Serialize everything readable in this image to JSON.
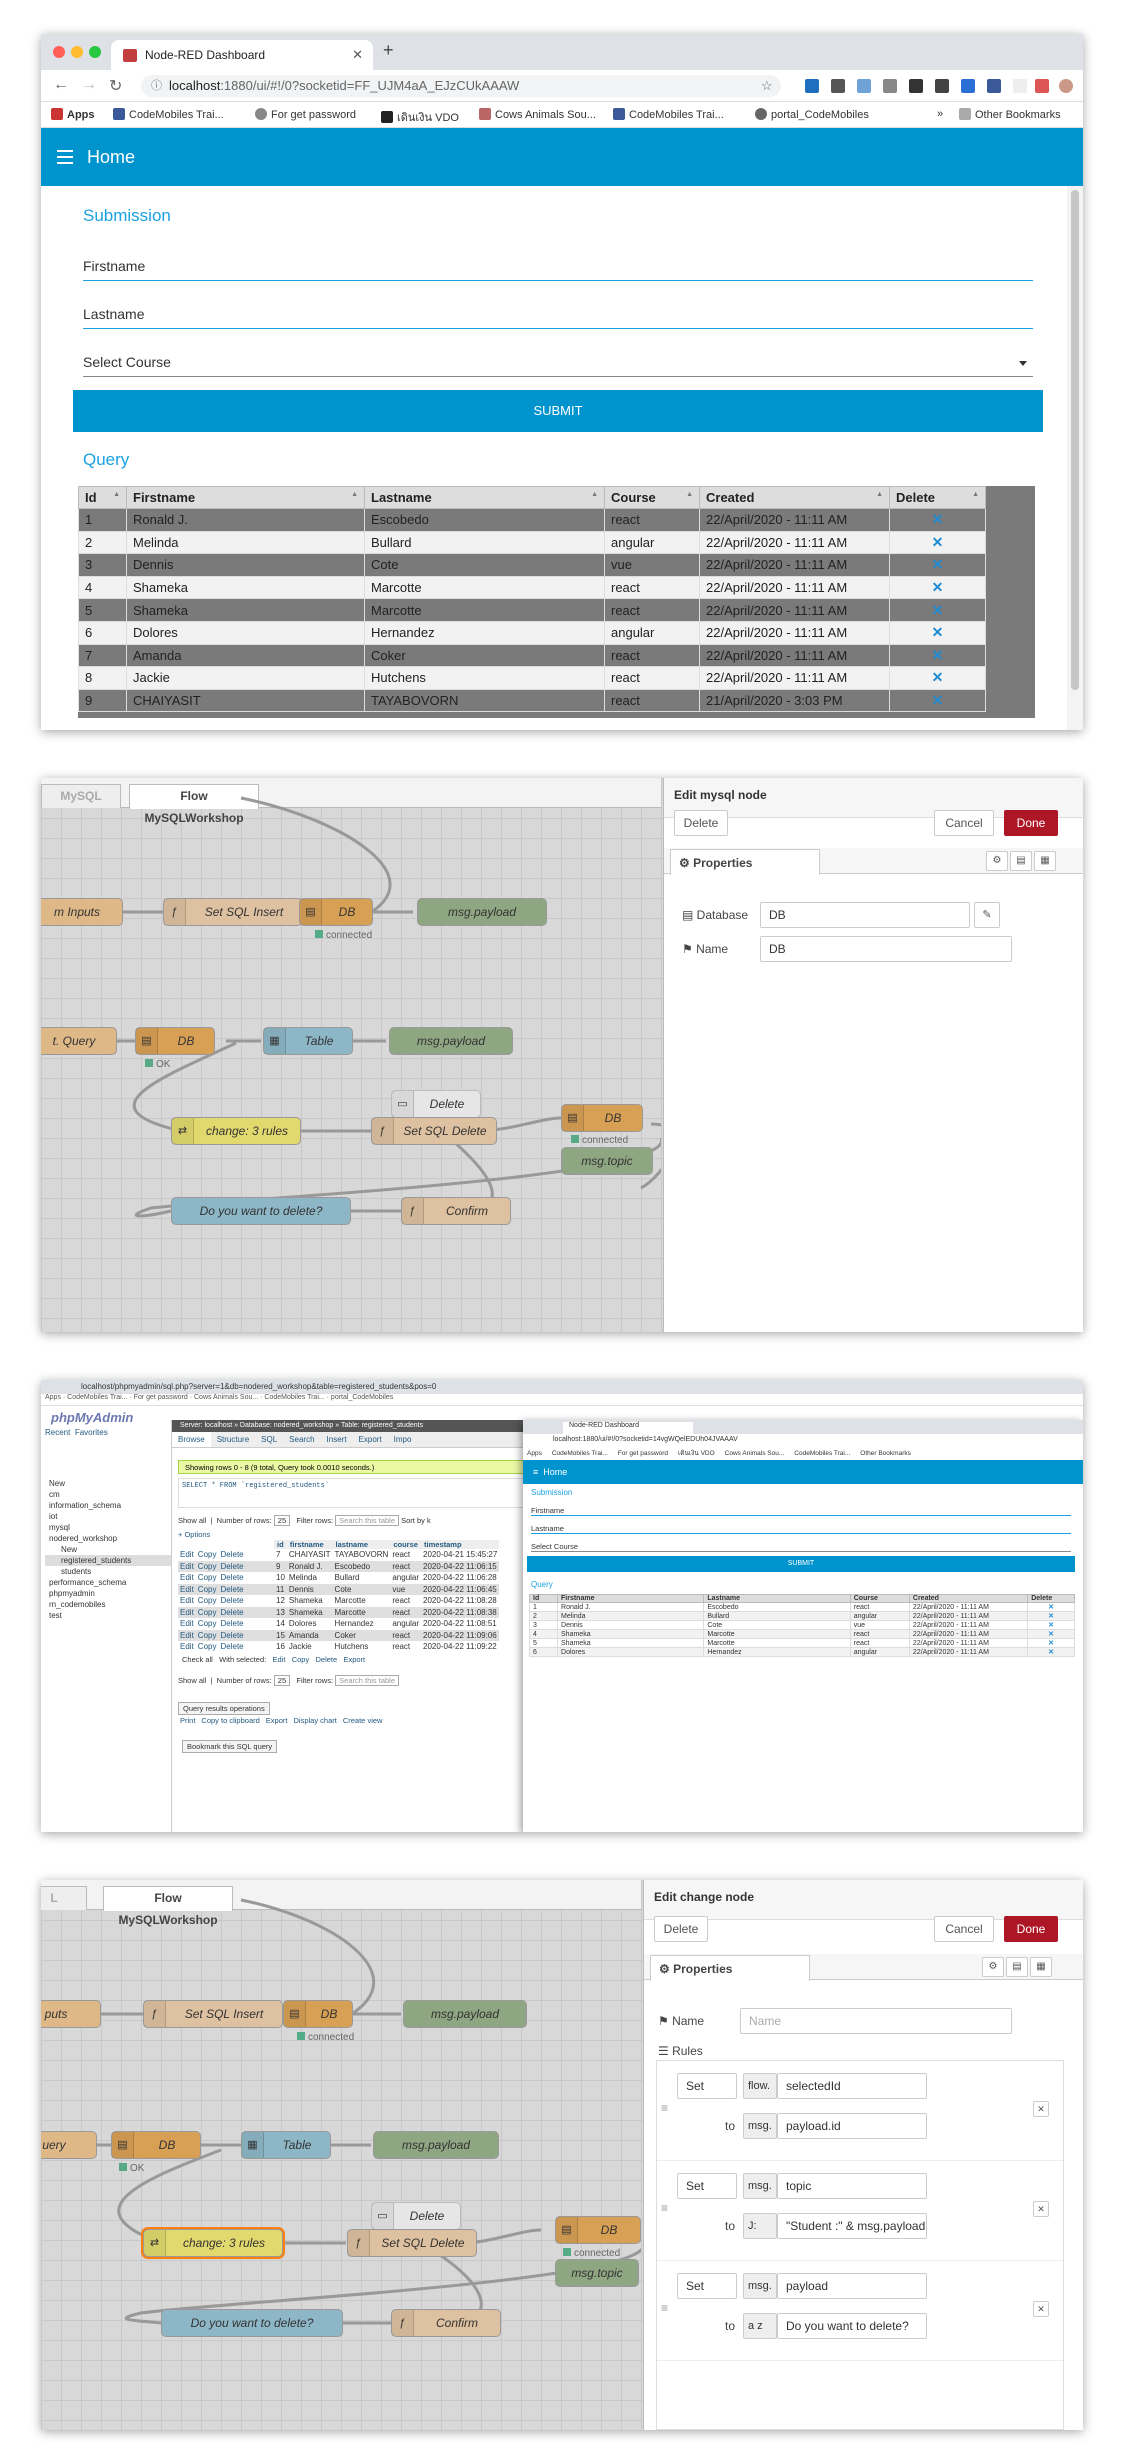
{
  "dashboard": {
    "tab_title": "Node-RED Dashboard",
    "url_host": "localhost",
    "url_path": ":1880/ui/#!/0?socketid=FF_UJM4aA_EJzCUkAAAW",
    "bookmarks": [
      "Apps",
      "CodeMobiles Trai...",
      "For get password",
      "เดินเงิน VDO",
      "Cows Animals Sou...",
      "CodeMobiles Trai...",
      "portal_CodeMobiles",
      "»",
      "Other Bookmarks"
    ],
    "header_title": "Home",
    "submission_title": "Submission",
    "firstname_label": "Firstname",
    "lastname_label": "Lastname",
    "course_label": "Select Course",
    "submit_label": "SUBMIT",
    "query_title": "Query",
    "columns": [
      "Id",
      "Firstname",
      "Lastname",
      "Course",
      "Created",
      "Delete"
    ],
    "rows": [
      [
        "1",
        "Ronald J.",
        "Escobedo",
        "react",
        "22/April/2020 - 11:11 AM",
        "✕"
      ],
      [
        "2",
        "Melinda",
        "Bullard",
        "angular",
        "22/April/2020 - 11:11 AM",
        "✕"
      ],
      [
        "3",
        "Dennis",
        "Cote",
        "vue",
        "22/April/2020 - 11:11 AM",
        "✕"
      ],
      [
        "4",
        "Shameka",
        "Marcotte",
        "react",
        "22/April/2020 - 11:11 AM",
        "✕"
      ],
      [
        "5",
        "Shameka",
        "Marcotte",
        "react",
        "22/April/2020 - 11:11 AM",
        "✕"
      ],
      [
        "6",
        "Dolores",
        "Hernandez",
        "angular",
        "22/April/2020 - 11:11 AM",
        "✕"
      ],
      [
        "7",
        "Amanda",
        "Coker",
        "react",
        "22/April/2020 - 11:11 AM",
        "✕"
      ],
      [
        "8",
        "Jackie",
        "Hutchens",
        "react",
        "22/April/2020 - 11:11 AM",
        "✕"
      ],
      [
        "9",
        "CHAIYASIT",
        "TAYABOVORN",
        "react",
        "21/April/2020 - 3:03 PM",
        "✕"
      ]
    ]
  },
  "flow1": {
    "tab_left": "MySQL",
    "tab_active": "Flow MySQLWorkshop",
    "nodes": {
      "form_inputs": "m Inputs",
      "set_sql_insert": "Set SQL Insert",
      "db1": "DB",
      "payload1": "msg.payload",
      "query": "t. Query",
      "db2": "DB",
      "table": "Table",
      "payload2": "msg.payload",
      "delete": "Delete",
      "change": "change: 3 rules",
      "set_sql_delete": "Set SQL Delete",
      "db3": "DB",
      "topic": "msg.topic",
      "confirm_dialog": "Do you want to delete?",
      "confirm": "Confirm"
    },
    "status_connected": "connected",
    "status_ok": "OK",
    "tray_title": "Edit mysql node",
    "delete_btn": "Delete",
    "cancel_btn": "Cancel",
    "done_btn": "Done",
    "properties_tab": "Properties",
    "database_label": "Database",
    "database_value": "DB",
    "name_label": "Name",
    "name_value": "DB"
  },
  "pma": {
    "url": "localhost/phpmyadmin/sql.php?server=1&db=nodered_workshop&table=registered_students&pos=0",
    "logo": "phpMyAdmin",
    "recent": "Recent",
    "favorites": "Favorites",
    "breadcrumb": "Server: localhost » Database: nodered_workshop » Table: registered_students",
    "tabs": [
      "Browse",
      "Structure",
      "SQL",
      "Search",
      "Insert",
      "Export",
      "Impo"
    ],
    "success": "Showing rows 0 - 8 (9 total, Query took 0.0010 seconds.)",
    "sql": "SELECT * FROM `registered_students`",
    "show_all": "Show all",
    "number_rows": "Number of rows:",
    "rows_value": "25",
    "filter": "Filter rows:",
    "filter_ph": "Search this table",
    "sort": "Sort by k",
    "options": "+ Options",
    "cols": [
      "id",
      "firstname",
      "lastname",
      "course",
      "timestamp"
    ],
    "rows": [
      [
        "7",
        "CHAIYASIT",
        "TAYABOVORN",
        "react",
        "2020-04-21 15:45:27"
      ],
      [
        "9",
        "Ronald J.",
        "Escobedo",
        "react",
        "2020-04-22 11:06:15"
      ],
      [
        "10",
        "Melinda",
        "Bullard",
        "angular",
        "2020-04-22 11:06:28"
      ],
      [
        "11",
        "Dennis",
        "Cote",
        "vue",
        "2020-04-22 11:06:45"
      ],
      [
        "12",
        "Shameka",
        "Marcotte",
        "react",
        "2020-04-22 11:08:28"
      ],
      [
        "13",
        "Shameka",
        "Marcotte",
        "react",
        "2020-04-22 11:08:38"
      ],
      [
        "14",
        "Dolores",
        "Hernandez",
        "angular",
        "2020-04-22 11:08:51"
      ],
      [
        "15",
        "Amanda",
        "Coker",
        "react",
        "2020-04-22 11:09:06"
      ],
      [
        "16",
        "Jackie",
        "Hutchens",
        "react",
        "2020-04-22 11:09:22"
      ]
    ],
    "row_actions": [
      "Edit",
      "Copy",
      "Delete"
    ],
    "check_all": "Check all",
    "with_selected": "With selected:",
    "bulk": [
      "Edit",
      "Copy",
      "Delete",
      "Export"
    ],
    "query_ops": "Query results operations",
    "ops": [
      "Print",
      "Copy to clipboard",
      "Export",
      "Display chart",
      "Create view"
    ],
    "bookmark": "Bookmark this SQL query",
    "tree": [
      "New",
      "cm",
      "information_schema",
      "iot",
      "mysql",
      "nodered_workshop",
      "New",
      "registered_students",
      "students",
      "performance_schema",
      "phpmyadmin",
      "rn_codemobiles",
      "test"
    ],
    "mini_url": "localhost:1880/ui/#!/0?socketid=14vgWQelEDUh04JVAAAV",
    "mini_bookmarks": [
      "Apps",
      "CodeMobiles Trai...",
      "For get password",
      "เดินเงิน VDO",
      "Cows Animals Sou...",
      "CodeMobiles Trai...",
      "Other Bookmarks"
    ],
    "mini_rows": [
      [
        "1",
        "Ronald J.",
        "Escobedo",
        "react",
        "22/April/2020 - 11:11 AM"
      ],
      [
        "2",
        "Melinda",
        "Bullard",
        "angular",
        "22/April/2020 - 11:11 AM"
      ],
      [
        "3",
        "Dennis",
        "Cote",
        "vue",
        "22/April/2020 - 11:11 AM"
      ],
      [
        "4",
        "Shameka",
        "Marcotte",
        "react",
        "22/April/2020 - 11:11 AM"
      ],
      [
        "5",
        "Shameka",
        "Marcotte",
        "react",
        "22/April/2020 - 11:11 AM"
      ],
      [
        "6",
        "Dolores",
        "Hernandez",
        "angular",
        "22/April/2020 - 11:11 AM"
      ]
    ]
  },
  "flow2": {
    "tab_active": "Flow MySQLWorkshop",
    "tray_title": "Edit change node",
    "delete_btn": "Delete",
    "cancel_btn": "Cancel",
    "done_btn": "Done",
    "properties_tab": "Properties",
    "name_label": "Name",
    "name_ph": "Name",
    "rules_label": "Rules",
    "rules": [
      {
        "action": "Set",
        "target_type": "flow.",
        "target": "selectedId",
        "to_type": "msg.",
        "to": "payload.id"
      },
      {
        "action": "Set",
        "target_type": "msg.",
        "target": "topic",
        "to_type": "J:",
        "to": "\"Student :\" & msg.payload.firstna"
      },
      {
        "action": "Set",
        "target_type": "msg.",
        "target": "payload",
        "to_type": "a z",
        "to": "Do you want to delete?"
      }
    ],
    "to_label": "to"
  }
}
